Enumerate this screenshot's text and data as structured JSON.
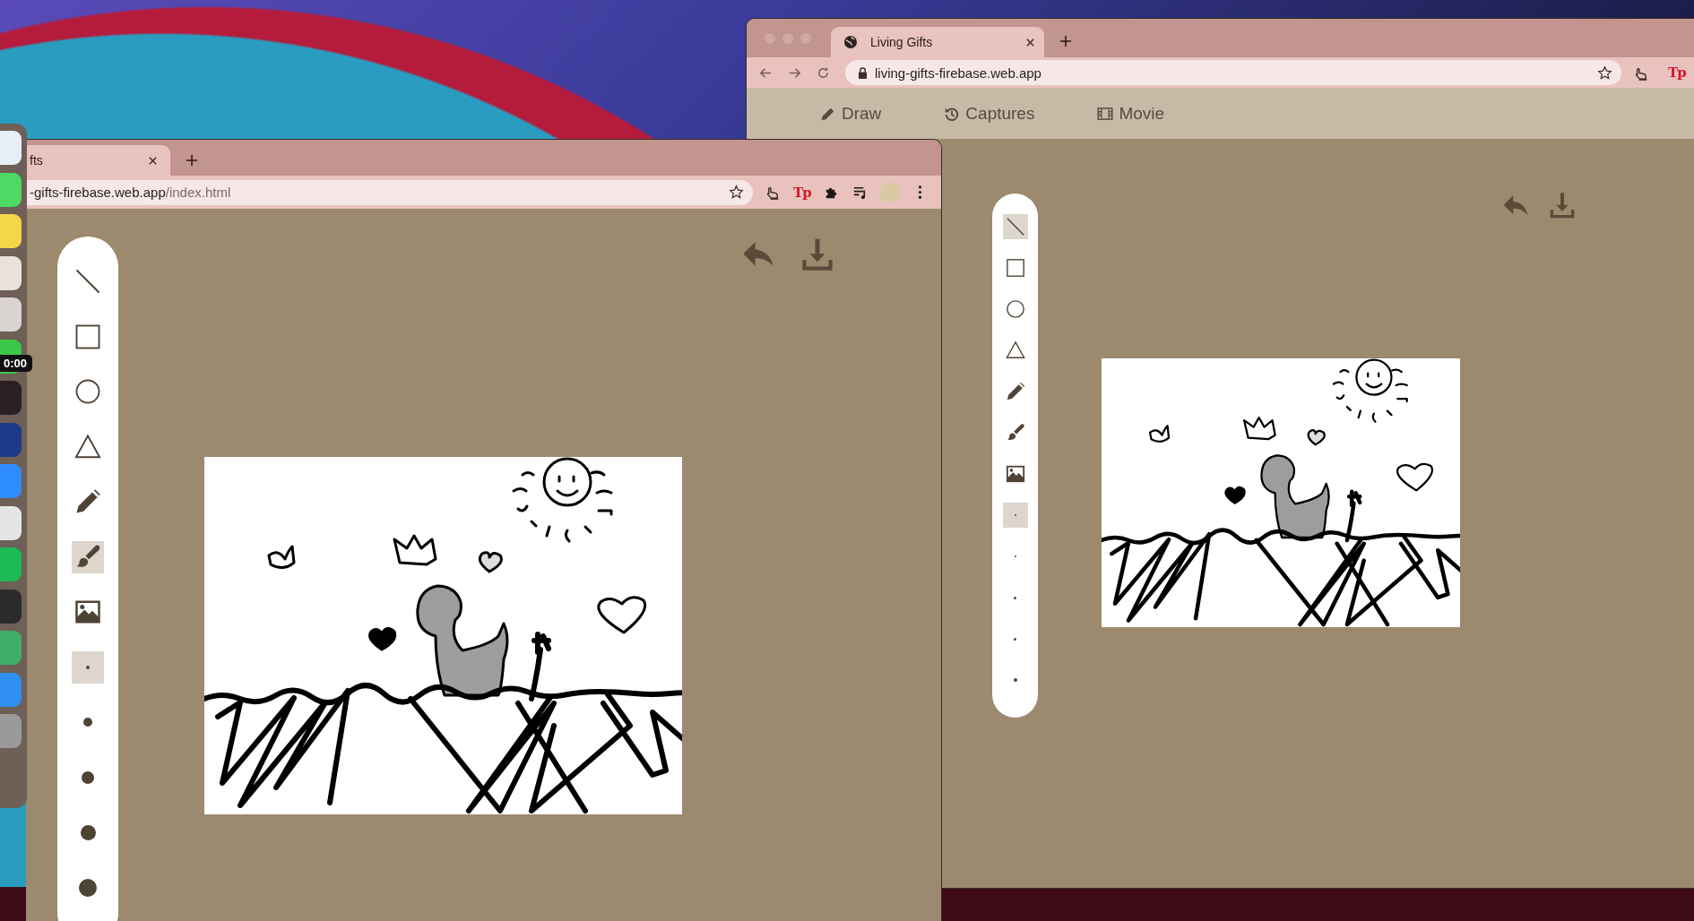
{
  "desktop": {
    "dock": {
      "timer": "0:00"
    }
  },
  "windows": [
    {
      "traffic_lights": true,
      "tab": {
        "title": "Living Gifts",
        "favicon": true
      },
      "address": {
        "nav_buttons": true,
        "lock": true,
        "host": "living-gifts-firebase.web.app"
      },
      "extensions": [
        {
          "kind": "hand"
        },
        {
          "kind": "text",
          "label": "Tp"
        }
      ],
      "nav": [
        {
          "kind": "draw",
          "label": "Draw"
        },
        {
          "kind": "captures",
          "label": "Captures"
        },
        {
          "kind": "movie",
          "label": "Movie"
        }
      ],
      "tools": [
        {
          "kind": "line",
          "selected": true
        },
        {
          "kind": "rect",
          "selected": false
        },
        {
          "kind": "circle",
          "selected": false
        },
        {
          "kind": "triangle",
          "selected": false
        },
        {
          "kind": "pencil",
          "selected": false
        },
        {
          "kind": "brush",
          "selected": false
        },
        {
          "kind": "image",
          "selected": false
        }
      ],
      "sizes": [
        {
          "selected": true
        },
        {
          "selected": false
        },
        {
          "selected": false
        },
        {
          "selected": false
        },
        {
          "selected": false
        }
      ]
    },
    {
      "traffic_lights": false,
      "tab": {
        "title": "fts",
        "favicon": false
      },
      "address": {
        "nav_buttons": false,
        "lock": false,
        "host": "-gifts-firebase.web.app",
        "path": "/index.html"
      },
      "extensions": [
        {
          "kind": "hand"
        },
        {
          "kind": "text",
          "label": "Tp"
        },
        {
          "kind": "puzzle"
        },
        {
          "kind": "playlist"
        },
        {
          "kind": "avatar"
        },
        {
          "kind": "menu"
        }
      ],
      "tools": [
        {
          "kind": "line",
          "selected": false
        },
        {
          "kind": "rect",
          "selected": false
        },
        {
          "kind": "circle",
          "selected": false
        },
        {
          "kind": "triangle",
          "selected": false
        },
        {
          "kind": "pencil",
          "selected": false
        },
        {
          "kind": "brush",
          "selected": true
        },
        {
          "kind": "image",
          "selected": false
        }
      ],
      "sizes": [
        {
          "selected": true
        },
        {
          "selected": false
        },
        {
          "selected": false
        },
        {
          "selected": false
        },
        {
          "selected": false
        }
      ]
    }
  ]
}
